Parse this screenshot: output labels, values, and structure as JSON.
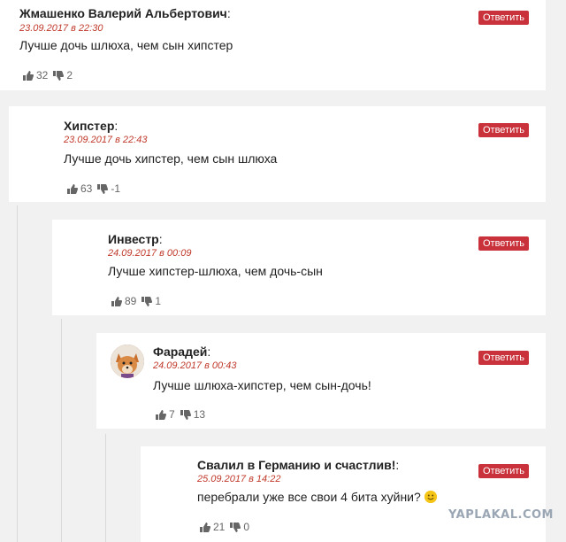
{
  "comments": [
    {
      "author": "Жмашенко Валерий Альбертович",
      "colon": ":",
      "date": "23.09.2017 в 22:30",
      "text": "Лучше дочь шлюха, чем сын хипстер",
      "likes": "32",
      "dislikes": "2",
      "reply_label": "Ответить"
    },
    {
      "author": "Хипстер",
      "colon": ":",
      "date": "23.09.2017 в 22:43",
      "text": "Лучше дочь хипстер, чем сын шлюха",
      "likes": "63",
      "dislikes": "-1",
      "reply_label": "Ответить"
    },
    {
      "author": "Инвестр",
      "colon": ":",
      "date": "24.09.2017 в 00:09",
      "text": "Лучше хипстер-шлюха, чем дочь-сын",
      "likes": "89",
      "dislikes": "1",
      "reply_label": "Ответить"
    },
    {
      "author": "Фарадей",
      "colon": ":",
      "date": "24.09.2017 в 00:43",
      "text": "Лучше шлюха-хипстер, чем сын-дочь!",
      "likes": "7",
      "dislikes": "13",
      "reply_label": "Ответить"
    },
    {
      "author": "Свалил в Германию и счастлив!",
      "colon": ":",
      "date": "25.09.2017 в 14:22",
      "text": "перебрали уже все свои 4 бита хуйни?",
      "likes": "21",
      "dislikes": "0",
      "reply_label": "Ответить"
    }
  ],
  "watermark": "YAPLAKAL.COM",
  "icons": {
    "like": "thumbs-up-icon",
    "dislike": "thumbs-down-icon",
    "emoji": "smiley-icon",
    "avatar": "fox-avatar"
  }
}
